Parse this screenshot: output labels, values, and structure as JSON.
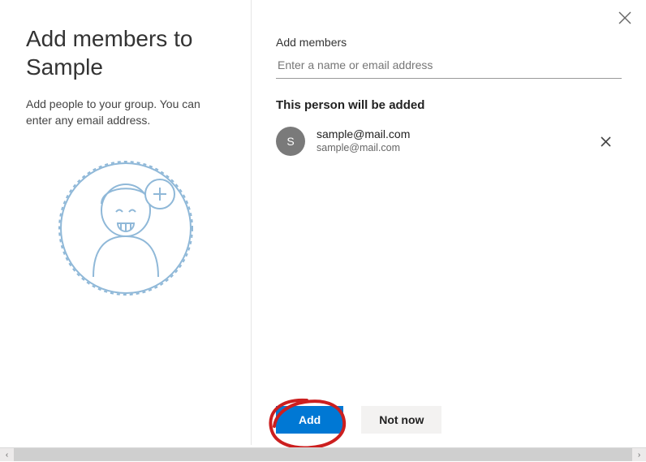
{
  "left": {
    "title": "Add members to Sample",
    "description": "Add people to your group. You can enter any email address."
  },
  "right": {
    "field_label": "Add members",
    "search_placeholder": "Enter a name or email address",
    "added_title": "This person will be added",
    "member": {
      "initial": "S",
      "name": "sample@mail.com",
      "email": "sample@mail.com"
    },
    "buttons": {
      "add": "Add",
      "not_now": "Not now"
    }
  }
}
